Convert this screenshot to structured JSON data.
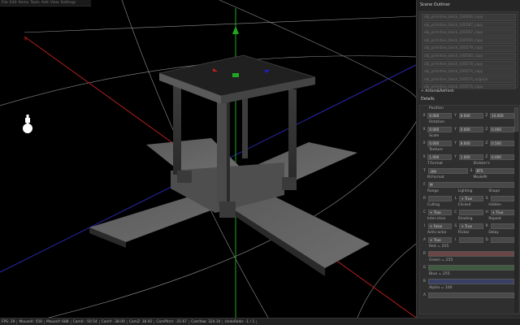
{
  "menu": [
    "File",
    "Edit",
    "Items",
    "Tools",
    "Add",
    "View",
    "Settings"
  ],
  "outliner": {
    "title": "Scene Outliner",
    "items": [
      "obj_primitive_block_100640_copy",
      "obj_primitive_block_100587_copy",
      "obj_primitive_block_100587_copy",
      "obj_primitive_block_100590_copy",
      "obj_primitive_block_100579_copy",
      "obj_primitive_block_100560_copy",
      "obj_primitive_block_100578_copy",
      "obj_primitive_block_100574_copy",
      "obj_primitive_block_100574_original",
      "obj_primitive_block_100574_copy"
    ]
  },
  "refresh_label": "+ Actors&Refresh",
  "details": {
    "title": "Details",
    "position": {
      "label": "Position",
      "x": "0.000",
      "y": "8.000",
      "z": "10.000"
    },
    "rotation": {
      "label": "Rotation",
      "x": "0.000",
      "y": "0.000",
      "z": "0.000"
    },
    "scale": {
      "label": "Scale",
      "x": "0.000",
      "y": "8.000",
      "z": "0.500"
    },
    "texture": {
      "label": "Texture",
      "x": "1.000",
      "y": "1.000",
      "z": "0.000"
    },
    "tformat": {
      "label_a": "T.Format",
      "label_b": "Shdster's",
      "value_a": ".jpg",
      "value_b": "BTS"
    },
    "mformat": {
      "label_a": "M.Format",
      "label_b": "ModelPr"
    },
    "f_field": {
      "label": "F",
      "value": "M"
    },
    "range_hdr": [
      "Range",
      "Lighting",
      "Shape"
    ],
    "range": {
      "r": "",
      "lighting": "+ True",
      "s": ""
    },
    "culling_hdr": [
      "Culling",
      "Clicked",
      "Hidden"
    ],
    "culling": {
      "a": "+ True",
      "b": "",
      "c": "+ True"
    },
    "inter_hdr": [
      "Inter-ction",
      "Shading",
      "Repeat"
    ],
    "inter": {
      "a": "+ False",
      "b": "+ True",
      "c": ""
    },
    "act_hdr": [
      "Activ-actor",
      "Flicker",
      "Delay"
    ],
    "act": {
      "a": "+ True",
      "b": "",
      "c": ""
    },
    "red": "Red = 255",
    "green": "Green = 255",
    "blue": "Blue = 255",
    "alpha": "Alpha = 100",
    "colors": {
      "red": "#6b4646",
      "green": "#3f5a3f",
      "blue": "#3a3f66",
      "alpha": "#4a4a4a"
    }
  },
  "status": [
    "FPS: 29",
    "MouseX: 558",
    "MouseY: 688",
    "CamX: -50.54",
    "CamY: -38.00",
    "CamZ: 38.92",
    "CamPitch: -25.67",
    "CamYaw: 324.10",
    "UndoRedo: -1 / 1"
  ]
}
